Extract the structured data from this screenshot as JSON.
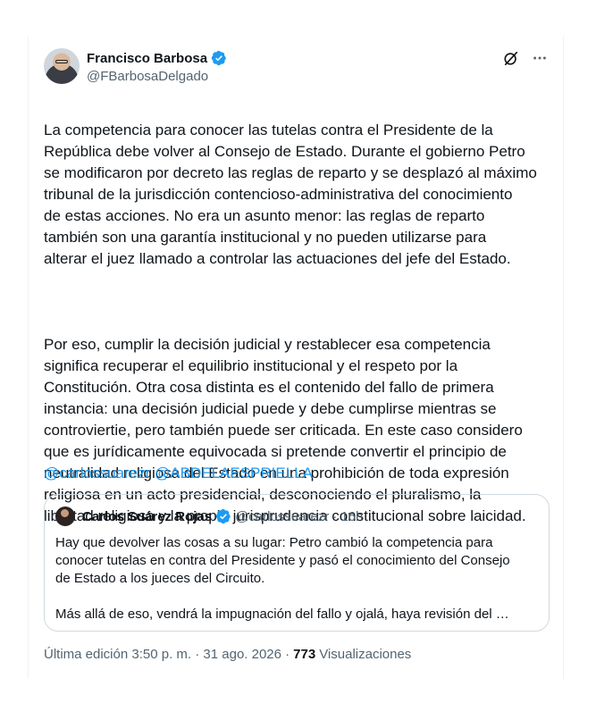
{
  "author": {
    "name": "Francisco Barbosa",
    "handle": "@FBarbosaDelgado",
    "verified_color": "#1d9bf0"
  },
  "tweet": {
    "paragraph1": "La competencia para conocer las tutelas contra el Presidente de la\nRepública debe volver al Consejo de Estado. Durante el gobierno Petro\nse modificaron por decreto las reglas de reparto y se desplazó al máximo\ntribunal de la jurisdicción contencioso-administrativa del conocimiento\nde estas acciones. No era un asunto menor: las reglas de reparto\ntambién son una garantía institucional y no pueden utilizarse para\nalterar el juez llamado a controlar las actuaciones del jefe del Estado.",
    "paragraph2": "Por eso, cumplir la decisión judicial y restablecer esa competencia\nsignifica recuperar el equilibrio institucional y el respeto por la\nConstitución. Otra cosa distinta es el contenido del fallo de primera\ninstancia: una decisión judicial puede y debe cumplirse mientras se\ncontroviertie, pero también puede ser criticada. En este caso considero\nque es jurídicamente equivocada si pretende convertir el principio de\nneutralidad religiosa del Estado en una prohibición de toda expresión\nreligiosa en un acto presidencial, desconociendo el pluralismo, la\nlibertad religiosa y la propia jurisprudencia constitucional sobre laicidad.",
    "mention1": "@carlossuarezr",
    "mention2": "@ABDELAESPRIELLA"
  },
  "quote": {
    "name": "Carlos Suárez Rojas",
    "handle": "@carlossuarezr",
    "separator": "·",
    "time": "16h",
    "text": "Hay que devolver las cosas a su lugar: Petro cambió la competencia para\nconocer tutelas en contra del Presidente y pasó el conocimiento del Consejo\nde Estado a los jueces del Circuito.\n\nMás allá de eso, vendrá la impugnación del fallo y ojalá, haya revisión del …"
  },
  "meta": {
    "edited": "Última edición 3:50 p. m. · 31 ago. 2026 ·",
    "views_count": "773",
    "views_label": "Visualizaciones"
  },
  "icons": {
    "grok": "grok-icon",
    "more": "more-icon",
    "verified": "verified-badge-icon"
  }
}
